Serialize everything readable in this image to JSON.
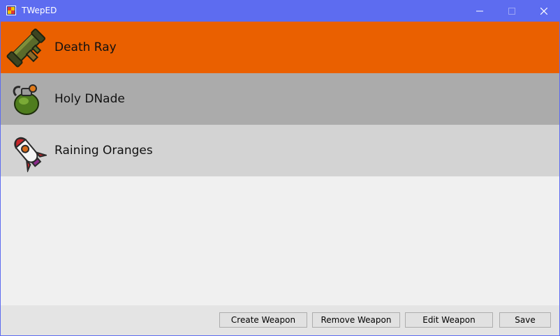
{
  "window": {
    "title": "TWepED",
    "titlebar_color": "#5d6cf0"
  },
  "weapons": [
    {
      "name": "Death Ray",
      "icon": "bazooka-icon",
      "row_color": "#ea6000",
      "selected": true
    },
    {
      "name": "Holy DNade",
      "icon": "grenade-icon",
      "row_color": "#ababab",
      "selected": false
    },
    {
      "name": "Raining Oranges",
      "icon": "rocket-icon",
      "row_color": "#d3d3d3",
      "selected": false
    }
  ],
  "actions": {
    "create": "Create Weapon",
    "remove": "Remove Weapon",
    "edit": "Edit Weapon",
    "save": "Save"
  }
}
